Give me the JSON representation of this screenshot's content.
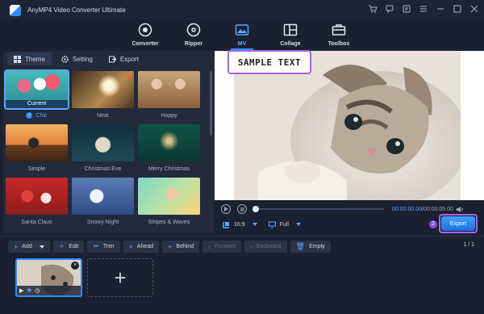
{
  "app": {
    "title": "AnyMP4 Video Converter Ultimate"
  },
  "window_controls": [
    "cart-icon",
    "feedback-icon",
    "help-icon",
    "menu-icon",
    "minimize-icon",
    "maximize-icon",
    "close-icon"
  ],
  "nav": {
    "items": [
      {
        "label": "Converter",
        "icon": "converter-icon"
      },
      {
        "label": "Ripper",
        "icon": "ripper-icon"
      },
      {
        "label": "MV",
        "icon": "mv-icon",
        "active": true
      },
      {
        "label": "Collage",
        "icon": "collage-icon"
      },
      {
        "label": "Toolbox",
        "icon": "toolbox-icon"
      }
    ]
  },
  "panel": {
    "tabs": [
      {
        "label": "Theme",
        "icon": "grid-icon",
        "active": true
      },
      {
        "label": "Setting",
        "icon": "gear-icon"
      },
      {
        "label": "Export",
        "icon": "export-icon"
      }
    ],
    "themes": [
      {
        "name": "Chic",
        "selected": true,
        "current_label": "Current"
      },
      {
        "name": "Neat"
      },
      {
        "name": "Happy"
      },
      {
        "name": "Simple"
      },
      {
        "name": "Christmas Eve"
      },
      {
        "name": "Merry Christmas"
      },
      {
        "name": "Santa Claus"
      },
      {
        "name": "Snowy Night"
      },
      {
        "name": "Stripes & Waves"
      }
    ]
  },
  "preview": {
    "overlay_text": "SAMPLE TEXT"
  },
  "player": {
    "current_time": "00:00:00.00",
    "total_time": "00:00:05.00",
    "aspect_ratio": "16:9",
    "fit_mode": "Full",
    "progress": 0.0
  },
  "export": {
    "marker": "2",
    "button_label": "Export"
  },
  "toolbar": {
    "add_label": "Add",
    "edit_label": "Edit",
    "trim_label": "Trim",
    "ahead_label": "Ahead",
    "behind_label": "Behind",
    "forward_label": "Forward",
    "backward_label": "Backward",
    "empty_label": "Empty",
    "page_info": "1 / 1"
  },
  "timeline": {
    "add_symbol": "+"
  },
  "colors": {
    "accent": "#2d8cff",
    "highlight": "#a565e8",
    "background": "#1b2130"
  }
}
